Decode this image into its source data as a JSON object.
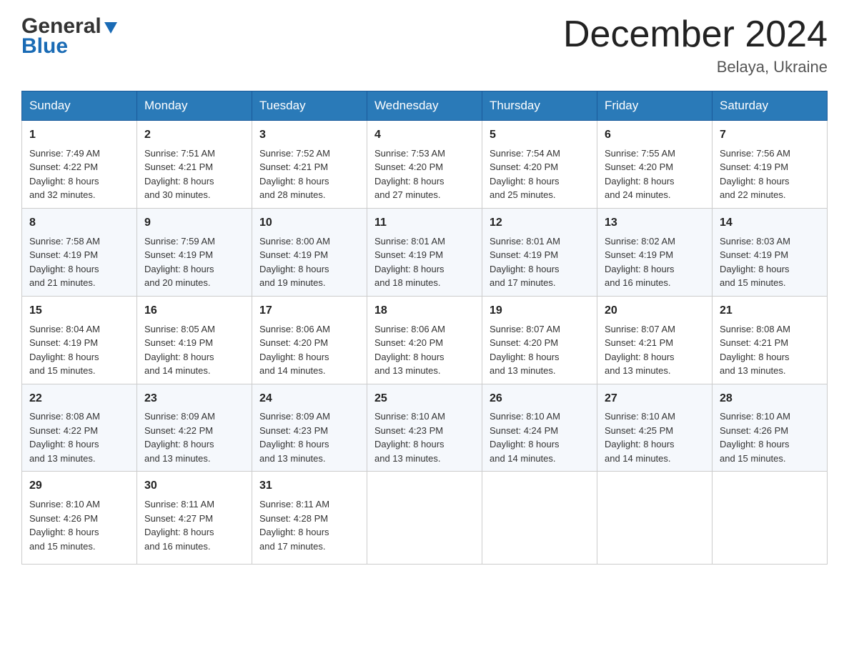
{
  "header": {
    "logo_general": "General",
    "logo_blue": "Blue",
    "month_title": "December 2024",
    "location": "Belaya, Ukraine"
  },
  "days_of_week": [
    "Sunday",
    "Monday",
    "Tuesday",
    "Wednesday",
    "Thursday",
    "Friday",
    "Saturday"
  ],
  "weeks": [
    [
      {
        "day": "1",
        "info": "Sunrise: 7:49 AM\nSunset: 4:22 PM\nDaylight: 8 hours\nand 32 minutes."
      },
      {
        "day": "2",
        "info": "Sunrise: 7:51 AM\nSunset: 4:21 PM\nDaylight: 8 hours\nand 30 minutes."
      },
      {
        "day": "3",
        "info": "Sunrise: 7:52 AM\nSunset: 4:21 PM\nDaylight: 8 hours\nand 28 minutes."
      },
      {
        "day": "4",
        "info": "Sunrise: 7:53 AM\nSunset: 4:20 PM\nDaylight: 8 hours\nand 27 minutes."
      },
      {
        "day": "5",
        "info": "Sunrise: 7:54 AM\nSunset: 4:20 PM\nDaylight: 8 hours\nand 25 minutes."
      },
      {
        "day": "6",
        "info": "Sunrise: 7:55 AM\nSunset: 4:20 PM\nDaylight: 8 hours\nand 24 minutes."
      },
      {
        "day": "7",
        "info": "Sunrise: 7:56 AM\nSunset: 4:19 PM\nDaylight: 8 hours\nand 22 minutes."
      }
    ],
    [
      {
        "day": "8",
        "info": "Sunrise: 7:58 AM\nSunset: 4:19 PM\nDaylight: 8 hours\nand 21 minutes."
      },
      {
        "day": "9",
        "info": "Sunrise: 7:59 AM\nSunset: 4:19 PM\nDaylight: 8 hours\nand 20 minutes."
      },
      {
        "day": "10",
        "info": "Sunrise: 8:00 AM\nSunset: 4:19 PM\nDaylight: 8 hours\nand 19 minutes."
      },
      {
        "day": "11",
        "info": "Sunrise: 8:01 AM\nSunset: 4:19 PM\nDaylight: 8 hours\nand 18 minutes."
      },
      {
        "day": "12",
        "info": "Sunrise: 8:01 AM\nSunset: 4:19 PM\nDaylight: 8 hours\nand 17 minutes."
      },
      {
        "day": "13",
        "info": "Sunrise: 8:02 AM\nSunset: 4:19 PM\nDaylight: 8 hours\nand 16 minutes."
      },
      {
        "day": "14",
        "info": "Sunrise: 8:03 AM\nSunset: 4:19 PM\nDaylight: 8 hours\nand 15 minutes."
      }
    ],
    [
      {
        "day": "15",
        "info": "Sunrise: 8:04 AM\nSunset: 4:19 PM\nDaylight: 8 hours\nand 15 minutes."
      },
      {
        "day": "16",
        "info": "Sunrise: 8:05 AM\nSunset: 4:19 PM\nDaylight: 8 hours\nand 14 minutes."
      },
      {
        "day": "17",
        "info": "Sunrise: 8:06 AM\nSunset: 4:20 PM\nDaylight: 8 hours\nand 14 minutes."
      },
      {
        "day": "18",
        "info": "Sunrise: 8:06 AM\nSunset: 4:20 PM\nDaylight: 8 hours\nand 13 minutes."
      },
      {
        "day": "19",
        "info": "Sunrise: 8:07 AM\nSunset: 4:20 PM\nDaylight: 8 hours\nand 13 minutes."
      },
      {
        "day": "20",
        "info": "Sunrise: 8:07 AM\nSunset: 4:21 PM\nDaylight: 8 hours\nand 13 minutes."
      },
      {
        "day": "21",
        "info": "Sunrise: 8:08 AM\nSunset: 4:21 PM\nDaylight: 8 hours\nand 13 minutes."
      }
    ],
    [
      {
        "day": "22",
        "info": "Sunrise: 8:08 AM\nSunset: 4:22 PM\nDaylight: 8 hours\nand 13 minutes."
      },
      {
        "day": "23",
        "info": "Sunrise: 8:09 AM\nSunset: 4:22 PM\nDaylight: 8 hours\nand 13 minutes."
      },
      {
        "day": "24",
        "info": "Sunrise: 8:09 AM\nSunset: 4:23 PM\nDaylight: 8 hours\nand 13 minutes."
      },
      {
        "day": "25",
        "info": "Sunrise: 8:10 AM\nSunset: 4:23 PM\nDaylight: 8 hours\nand 13 minutes."
      },
      {
        "day": "26",
        "info": "Sunrise: 8:10 AM\nSunset: 4:24 PM\nDaylight: 8 hours\nand 14 minutes."
      },
      {
        "day": "27",
        "info": "Sunrise: 8:10 AM\nSunset: 4:25 PM\nDaylight: 8 hours\nand 14 minutes."
      },
      {
        "day": "28",
        "info": "Sunrise: 8:10 AM\nSunset: 4:26 PM\nDaylight: 8 hours\nand 15 minutes."
      }
    ],
    [
      {
        "day": "29",
        "info": "Sunrise: 8:10 AM\nSunset: 4:26 PM\nDaylight: 8 hours\nand 15 minutes."
      },
      {
        "day": "30",
        "info": "Sunrise: 8:11 AM\nSunset: 4:27 PM\nDaylight: 8 hours\nand 16 minutes."
      },
      {
        "day": "31",
        "info": "Sunrise: 8:11 AM\nSunset: 4:28 PM\nDaylight: 8 hours\nand 17 minutes."
      },
      {
        "day": "",
        "info": ""
      },
      {
        "day": "",
        "info": ""
      },
      {
        "day": "",
        "info": ""
      },
      {
        "day": "",
        "info": ""
      }
    ]
  ]
}
